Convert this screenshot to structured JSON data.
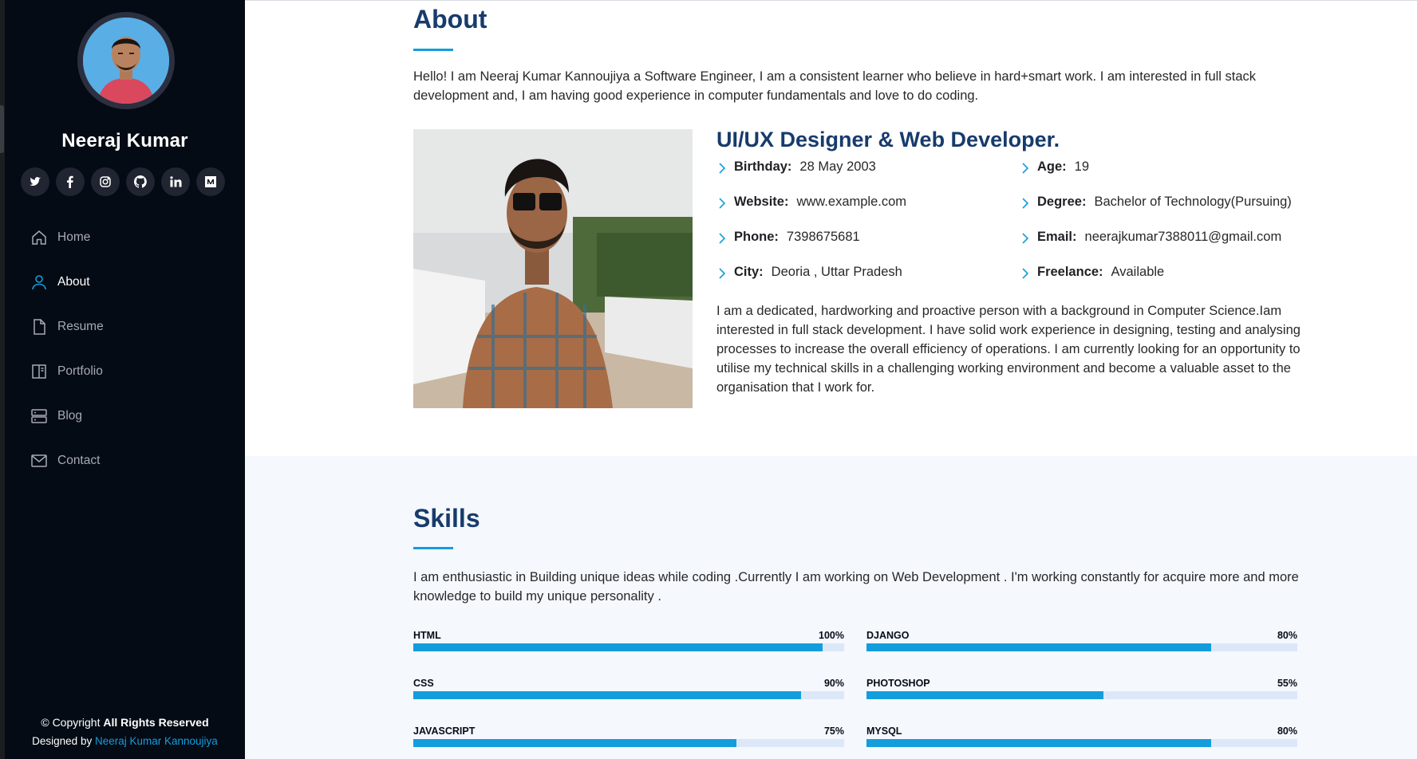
{
  "sidebar": {
    "name": "Neeraj Kumar",
    "social": [
      "twitter-icon",
      "facebook-icon",
      "instagram-icon",
      "github-icon",
      "linkedin-icon",
      "medium-icon"
    ],
    "nav": [
      {
        "label": "Home",
        "icon": "home-icon",
        "active": false
      },
      {
        "label": "About",
        "icon": "person-icon",
        "active": true
      },
      {
        "label": "Resume",
        "icon": "file-icon",
        "active": false
      },
      {
        "label": "Portfolio",
        "icon": "book-icon",
        "active": false
      },
      {
        "label": "Blog",
        "icon": "server-icon",
        "active": false
      },
      {
        "label": "Contact",
        "icon": "envelope-icon",
        "active": false
      }
    ],
    "footer": {
      "copyright_prefix": "© Copyright",
      "copyright_bold": "All Rights Reserved",
      "designed_prefix": "Designed by",
      "designed_link": "Neeraj Kumar Kannoujiya"
    }
  },
  "about": {
    "title": "About",
    "intro": "Hello! I am Neeraj Kumar Kannoujiya a Software Engineer, I am a consistent learner who believe in hard+smart work. I am interested in full stack development and, I am having good experience in computer fundamentals and love to do coding.",
    "role": "UI/UX Designer & Web Developer.",
    "info_left": [
      {
        "key": "Birthday:",
        "value": "28 May 2003"
      },
      {
        "key": "Website:",
        "value": "www.example.com"
      },
      {
        "key": "Phone:",
        "value": "7398675681"
      },
      {
        "key": "City:",
        "value": "Deoria , Uttar Pradesh"
      }
    ],
    "info_right": [
      {
        "key": "Age:",
        "value": "19"
      },
      {
        "key": "Degree:",
        "value": "Bachelor of Technology(Pursuing)"
      },
      {
        "key": "Email:",
        "value": "neerajkumar7388011@gmail.com"
      },
      {
        "key": "Freelance:",
        "value": "Available"
      }
    ],
    "description": "I am a dedicated, hardworking and proactive person with a background in Computer Science.Iam interested in full stack development. I have solid work experience in designing, testing and analysing processes to increase the overall efficiency of operations. I am currently looking for an opportunity to utilise my technical skills in a challenging working environment and become a valuable asset to the organisation that I work for."
  },
  "skills": {
    "title": "Skills",
    "intro": "I am enthusiastic in Building unique ideas while coding .Currently I am working on Web Development . I'm working constantly for acquire more and more knowledge to build my unique personality .",
    "items": [
      {
        "name": "HTML",
        "percent_label": "100%",
        "fill": 0.95
      },
      {
        "name": "DJANGO",
        "percent_label": "80%",
        "fill": 0.8
      },
      {
        "name": "CSS",
        "percent_label": "90%",
        "fill": 0.9
      },
      {
        "name": "PHOTOSHOP",
        "percent_label": "55%",
        "fill": 0.55
      },
      {
        "name": "JAVASCRIPT",
        "percent_label": "75%",
        "fill": 0.75
      },
      {
        "name": "MYSQL",
        "percent_label": "80%",
        "fill": 0.8
      }
    ]
  },
  "colors": {
    "accent": "#149ddd",
    "heading": "#173b6c",
    "sidebar_bg": "#040b14",
    "skills_bg": "#f5f8fd"
  }
}
